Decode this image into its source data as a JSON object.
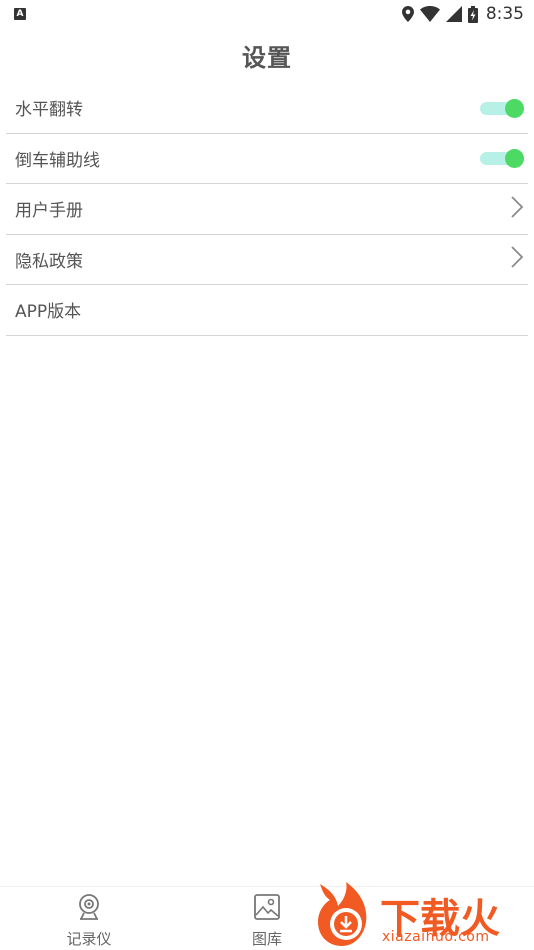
{
  "status_bar": {
    "notification_letter": "A",
    "time": "8:35",
    "icons": [
      "location-icon",
      "wifi-icon",
      "cell-signal-icon",
      "battery-charging-icon"
    ]
  },
  "header": {
    "title": "设置"
  },
  "settings": {
    "rows": [
      {
        "label": "水平翻转",
        "control": "toggle",
        "on": true
      },
      {
        "label": "倒车辅助线",
        "control": "toggle",
        "on": true
      },
      {
        "label": "用户手册",
        "control": "chevron"
      },
      {
        "label": "隐私政策",
        "control": "chevron"
      },
      {
        "label": "APP版本",
        "control": "none"
      }
    ]
  },
  "bottom_nav": {
    "items": [
      {
        "label": "记录仪",
        "icon": "camera-icon"
      },
      {
        "label": "图库",
        "icon": "gallery-icon"
      }
    ]
  },
  "watermark": {
    "text": "下载火",
    "url": "xiazaihuo.com"
  },
  "colors": {
    "toggle_track": "#b6f0e7",
    "toggle_thumb": "#4cd964",
    "watermark": "#f15a22",
    "divider": "#d4d4d4"
  }
}
